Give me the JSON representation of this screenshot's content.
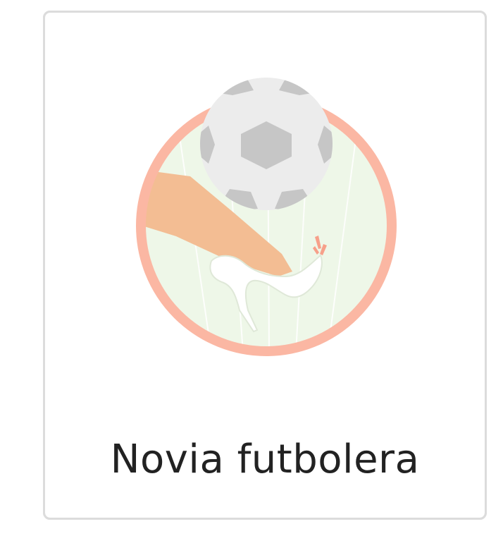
{
  "badge": {
    "title": "Novia futbolera",
    "icon": "soccer-ball-high-heel-icon",
    "colors": {
      "ring": "#fbb7a3",
      "field": "#eef7e8",
      "ball_light": "#ececec",
      "ball_dark": "#c6c6c6",
      "leg": "#f3bd93",
      "shoe": "#ffffff",
      "impact": "#f7a08a"
    }
  }
}
